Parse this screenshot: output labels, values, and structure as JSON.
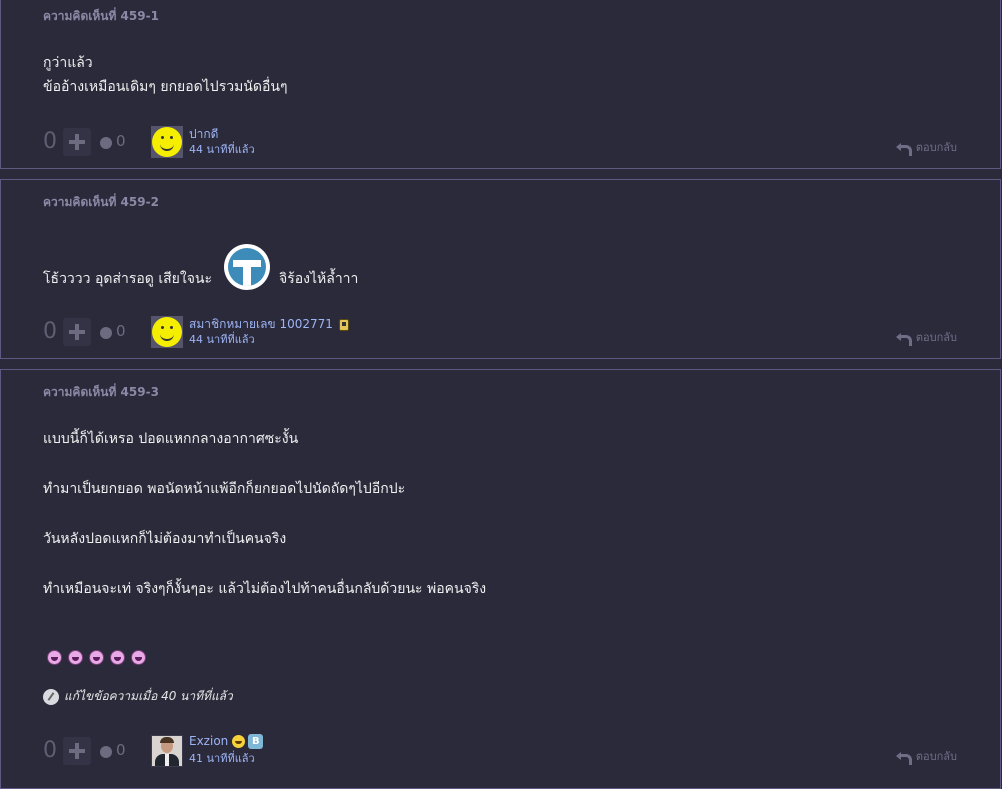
{
  "comments": [
    {
      "number": "ความคิดเห็นที่ 459-1",
      "lines": [
        "กูว่าแล้ว",
        "ข้ออ้างเหมือนเดิมๆ ยกยอดไปรวมนัดอื่นๆ"
      ],
      "votes": "0",
      "emotions": "0",
      "user": "ปากดี",
      "time": "44 นาทีที่แล้ว",
      "reply": "ตอบกลับ"
    },
    {
      "number": "ความคิดเห็นที่ 459-2",
      "lines": [
        "โธ้วววว อุดส่ารอดู เสียใจนะ"
      ],
      "tail": "จิร้องไห้ล้ำาา",
      "votes": "0",
      "emotions": "0",
      "user": "สมาชิกหมายเลข 1002771",
      "time": "44 นาทีที่แล้ว",
      "reply": "ตอบกลับ"
    },
    {
      "number": "ความคิดเห็นที่ 459-3",
      "lines": [
        "แบบนี้ก็ได้เหรอ ปอดแหกกลางอากาศซะงั้น",
        "ทำมาเป็นยกยอด พอนัดหน้าแพ้อีกก็ยกยอดไปนัดถัดๆไปอีกปะ",
        "วันหลังปอดแหกก็ไม่ต้องมาทำเป็นคนจริง",
        "ทำเหมือนจะเท่ จริงๆก็งั้นๆอะ แล้วไม่ต้องไปท้าคนอื่นกลับด้วยนะ พ่อคนจริง"
      ],
      "edited": "แก้ไขข้อความเมื่อ 40 นาทีที่แล้ว",
      "votes": "0",
      "emotions": "0",
      "user": "Exzion",
      "time": "41 นาทีที่แล้ว",
      "reply": "ตอบกลับ"
    }
  ],
  "icons": {
    "plus": "plus-icon",
    "emotion": "emotion-icon",
    "reply": "reply-icon",
    "sticker": "sticker-icon",
    "laugh": "laugh-emoji-icon",
    "edit": "edit-icon"
  },
  "colors": {
    "background": "#2b2a3b",
    "border": "#5c5a82",
    "link": "#9db4f5",
    "muted": "#6f6e86"
  }
}
